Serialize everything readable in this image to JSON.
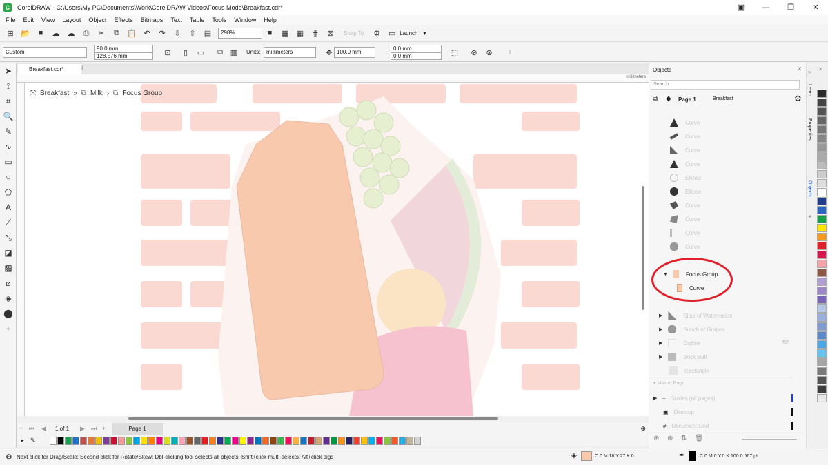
{
  "app": {
    "title": "CorelDRAW - C:\\Users\\My PC\\Documents\\Work\\CorelDRAW Videos\\Focus Mode\\Breakfast.cdr*"
  },
  "menu": [
    "File",
    "Edit",
    "View",
    "Layout",
    "Object",
    "Effects",
    "Bitmaps",
    "Text",
    "Table",
    "Tools",
    "Window",
    "Help"
  ],
  "toolbar1": {
    "zoom": "298%",
    "snap_to": "Snap To",
    "launch": "Launch"
  },
  "toolbar2": {
    "preset": "Custom",
    "width": "90.0 mm",
    "height": "128.576 mm",
    "units_label": "Units:",
    "units_value": "millimeters",
    "nudge": "100.0 mm",
    "dup_x": "0.0 mm",
    "dup_y": "0.0 mm"
  },
  "document_tab": {
    "label": "Breakfast.cdr*"
  },
  "ruler": {
    "units": "millimeters"
  },
  "breadcrumb": {
    "items": [
      "Breakfast",
      "Milk",
      "Focus Group"
    ]
  },
  "pagebar": {
    "page_info": "1 of 1",
    "page_tab": "Page 1"
  },
  "objects_panel": {
    "title": "Objects",
    "search_placeholder": "Search",
    "page": {
      "label": "Page 1",
      "doc": "Breakfast"
    },
    "items": [
      {
        "label": "Curve",
        "faded": true
      },
      {
        "label": "Curve",
        "faded": true
      },
      {
        "label": "Curve",
        "faded": true
      },
      {
        "label": "Curve",
        "faded": true
      },
      {
        "label": "Curve",
        "faded": true
      },
      {
        "label": "Ellipse",
        "faded": true
      },
      {
        "label": "Ellipse",
        "faded": true
      },
      {
        "label": "Curve",
        "faded": true
      },
      {
        "label": "Curve",
        "faded": true
      },
      {
        "label": "Curve",
        "faded": true
      },
      {
        "label": "Curve",
        "faded": true
      }
    ],
    "focus_group": {
      "label": "Focus Group",
      "child": "Curve"
    },
    "groups": [
      "Slice of Watermelon",
      "Bunch of Grapes",
      "Outline",
      "Brick wall",
      "Rectangle"
    ],
    "master_page": "Master Page",
    "master_items": [
      "Guides (all pages)",
      "Desktop",
      "Document Grid"
    ]
  },
  "side_tabs": [
    "Learn",
    "Properties",
    "Objects"
  ],
  "status": {
    "hint": "Next click for Drag/Scale; Second click for Rotate/Skew; Dbl-clicking tool selects all objects; Shift+click multi-selects; Alt+click digs",
    "fill": "C:0 M:18 Y:27 K:0",
    "outline": "C:0 M:0 Y:0 K:100  0.567 pt"
  },
  "colors": {
    "highlight": "#e0202a",
    "popsicle": "#f8c9ac",
    "brick": "#f9d9d2",
    "accent": "#27a844"
  },
  "palette_bottom": [
    "#ffffff",
    "#000000",
    "#18a050",
    "#2272c8",
    "#c0504d",
    "#e07b39",
    "#f2c000",
    "#7f3f98",
    "#c8102e",
    "#f29b9b",
    "#8dc63f",
    "#00a3e0",
    "#ffde00",
    "#ff7f00",
    "#e6007e",
    "#d7df23",
    "#00b0b9",
    "#f7a8b8",
    "#a0522d",
    "#666666",
    "#ee1c25",
    "#f58220",
    "#2e3192",
    "#00a651",
    "#ec008c",
    "#fff200",
    "#92278f",
    "#0072bc",
    "#f26522",
    "#8b4513",
    "#39b54a",
    "#ed145b",
    "#fbb040",
    "#1b75bc",
    "#be1e2d",
    "#d4a373",
    "#662d91",
    "#009444",
    "#f7941d",
    "#262262",
    "#ef4136",
    "#ffc20e",
    "#00aeef",
    "#d91c5c",
    "#8cc63f",
    "#f15a29",
    "#27aae1",
    "#c2b59b",
    "#d3d3d3"
  ],
  "palette_right": [
    "#2b2b2b",
    "#444444",
    "#555555",
    "#666666",
    "#777777",
    "#888888",
    "#999999",
    "#aaaaaa",
    "#bbbbbb",
    "#cccccc",
    "#dddddd",
    "#ffffff",
    "#1f3b8a",
    "#2c64c4",
    "#12a04a",
    "#ffe600",
    "#f39c1f",
    "#e0202a",
    "#d6164f",
    "#f5a3a8",
    "#8a5a44",
    "#b09fcf",
    "#9a88c8",
    "#7a66b8",
    "#b6c8e8",
    "#9ab0dc",
    "#7f9bd0",
    "#5f88c8",
    "#4ba8e8",
    "#63c4f0",
    "#a6a6a6",
    "#7a7a7a",
    "#555555",
    "#3c3c3c",
    "#e8e8e8"
  ]
}
